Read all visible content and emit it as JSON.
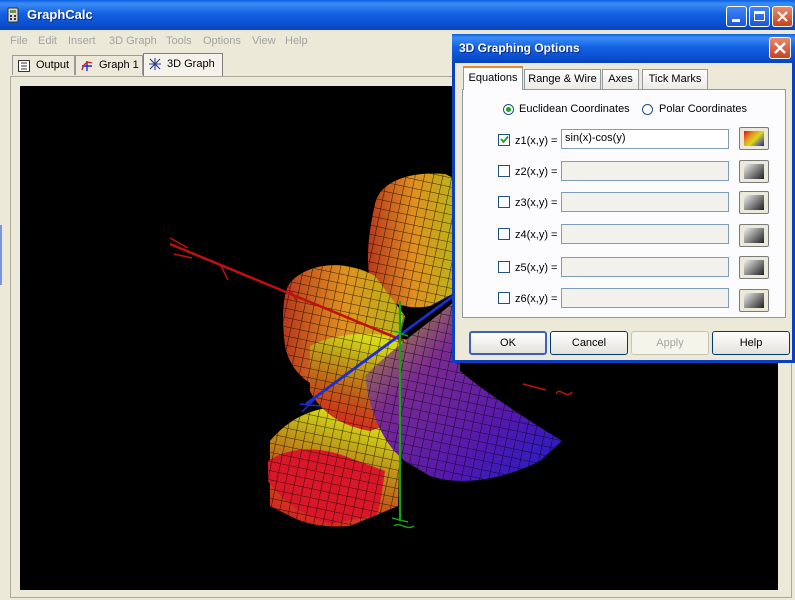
{
  "window": {
    "title": "GraphCalc"
  },
  "menu": [
    "File",
    "Edit",
    "Insert",
    "3D Graph",
    "Tools",
    "Options",
    "View",
    "Help"
  ],
  "doc_tabs": [
    {
      "label": "Output",
      "icon": "output-icon"
    },
    {
      "label": "Graph 1",
      "icon": "graph-2d-icon"
    },
    {
      "label": "3D Graph",
      "icon": "graph-3d-icon",
      "active": true
    }
  ],
  "dialog": {
    "title": "3D Graphing Options",
    "tabs": [
      {
        "label": "Equations",
        "active": true
      },
      {
        "label": "Range & Wire"
      },
      {
        "label": "Axes"
      },
      {
        "label": "Tick Marks"
      }
    ],
    "coordinates": {
      "euclidean_label": "Euclidean Coordinates",
      "polar_label": "Polar Coordinates",
      "selected": "euclidean"
    },
    "equations": [
      {
        "label": "z1(x,y) =",
        "checked": true,
        "value": "sin(x)-cos(y)",
        "color": "rainbow"
      },
      {
        "label": "z2(x,y) =",
        "checked": false,
        "value": "",
        "color": "gray"
      },
      {
        "label": "z3(x,y) =",
        "checked": false,
        "value": "",
        "color": "gray"
      },
      {
        "label": "z4(x,y) =",
        "checked": false,
        "value": "",
        "color": "gray"
      },
      {
        "label": "z5(x,y) =",
        "checked": false,
        "value": "",
        "color": "gray"
      },
      {
        "label": "z6(x,y) =",
        "checked": false,
        "value": "",
        "color": "gray"
      }
    ],
    "buttons": {
      "ok": "OK",
      "cancel": "Cancel",
      "apply": "Apply",
      "help": "Help"
    }
  },
  "colors": {
    "titlebar": "#0a5fe0",
    "x_axis": "#c01010",
    "y_axis": "#1a2fd0",
    "z_axis": "#18a018",
    "surface_gradient": [
      "#e01020",
      "#e0a020",
      "#d8d818",
      "#6a18a8",
      "#1e1ec8"
    ]
  }
}
